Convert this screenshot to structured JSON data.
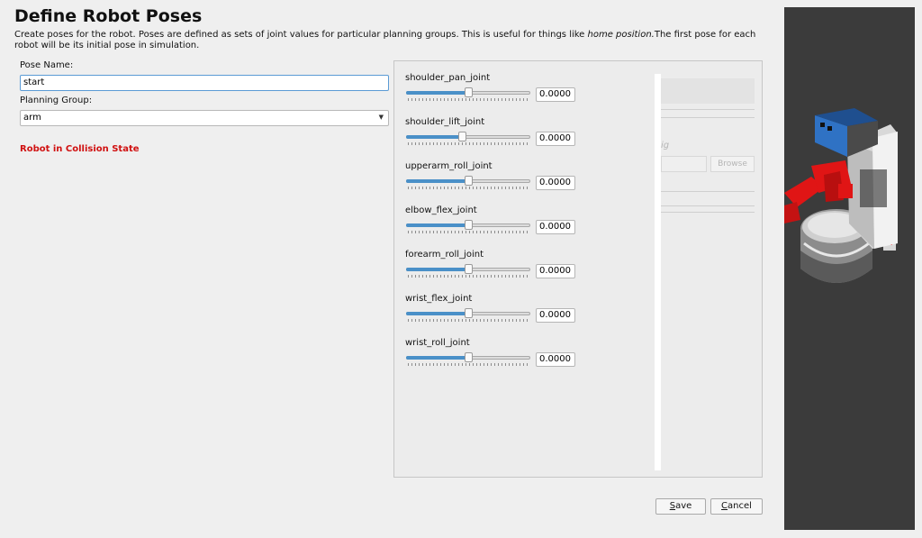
{
  "page": {
    "title": "Define Robot Poses",
    "description_pre": "Create poses for the robot. Poses are defined as sets of joint values for particular planning groups. This is useful for things like ",
    "description_em": "home position.",
    "description_post": "The first pose for each robot will be its initial pose in simulation."
  },
  "form": {
    "pose_name_label": "Pose Name:",
    "pose_name_value": "start",
    "planning_group_label": "Planning Group:",
    "planning_group_value": "arm",
    "collision_status": "Robot in Collision State"
  },
  "joints": [
    {
      "name": "shoulder_pan_joint",
      "value": "0.0000",
      "slider_fraction": 0.5
    },
    {
      "name": "shoulder_lift_joint",
      "value": "0.0000",
      "slider_fraction": 0.45
    },
    {
      "name": "upperarm_roll_joint",
      "value": "0.0000",
      "slider_fraction": 0.5
    },
    {
      "name": "elbow_flex_joint",
      "value": "0.0000",
      "slider_fraction": 0.5
    },
    {
      "name": "forearm_roll_joint",
      "value": "0.0000",
      "slider_fraction": 0.5
    },
    {
      "name": "wrist_flex_joint",
      "value": "0.0000",
      "slider_fraction": 0.5
    },
    {
      "name": "wrist_roll_joint",
      "value": "0.0000",
      "slider_fraction": 0.5
    }
  ],
  "background_dialog": {
    "partial_text": "ig",
    "browse_label": "Browse"
  },
  "buttons": {
    "save_mnemonic": "S",
    "save_rest": "ave",
    "cancel_mnemonic": "C",
    "cancel_rest": "ancel"
  },
  "colors": {
    "accent": "#4a90c8",
    "error": "#d01010",
    "robot_gripper": "#e01515",
    "robot_head": "#2f72c4",
    "viewport_bg": "#3b3b3b"
  }
}
